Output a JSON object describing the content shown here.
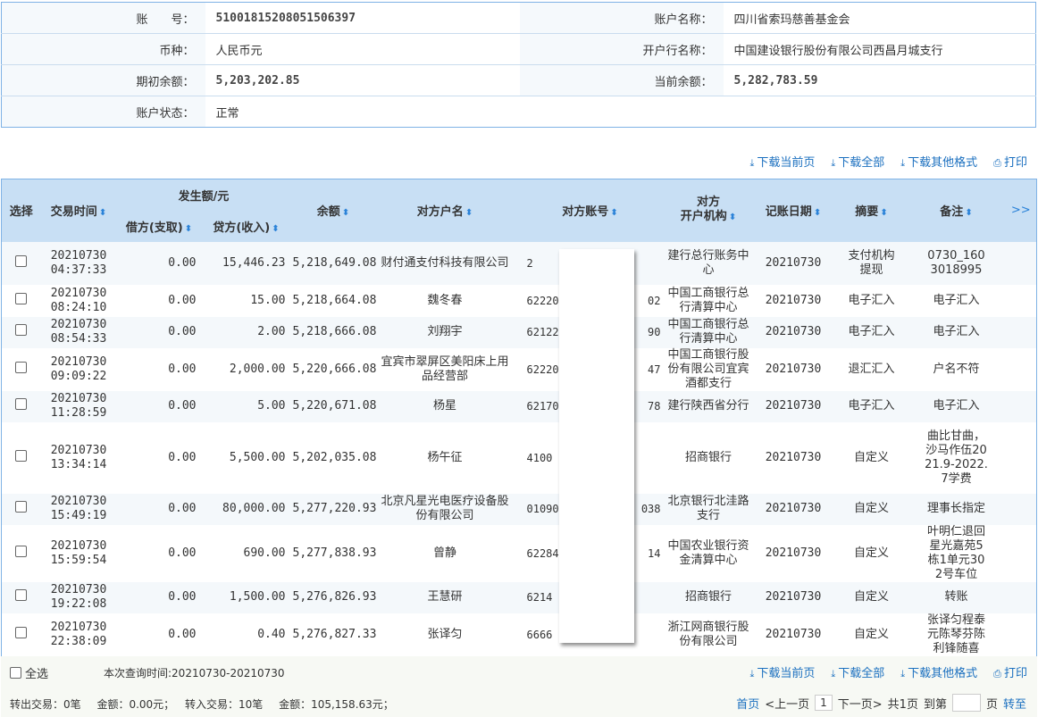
{
  "account": {
    "account_no_label": "账　　号：",
    "account_no": "51001815208051506397",
    "account_name_label": "账户名称：",
    "account_name": "四川省索玛慈善基金会",
    "currency_label": "币种：",
    "currency": "人民币元",
    "bank_label": "开户行名称：",
    "bank": "中国建设银行股份有限公司西昌月城支行",
    "opening_label": "期初余额：",
    "opening": "5,203,202.85",
    "current_label": "当前余额：",
    "current": "5,282,783.59",
    "status_label": "账户状态：",
    "status": "正常"
  },
  "actions": {
    "download_page": "下载当前页",
    "download_all": "下载全部",
    "download_other": "下载其他格式",
    "print": "打印"
  },
  "table": {
    "headers": {
      "select": "选择",
      "time": "交易时间",
      "amount_group": "发生额/元",
      "debit": "借方(支取)",
      "credit": "贷方(收入)",
      "balance": "余额",
      "cp_name": "对方户名",
      "cp_account": "对方账号",
      "cp_bank_1": "对方",
      "cp_bank_2": "开户机构",
      "post_date": "记账日期",
      "summary": "摘要",
      "remark": "备注",
      "more": ">>"
    },
    "rows": [
      {
        "date": "20210730",
        "time": "04:37:33",
        "debit": "0.00",
        "credit": "15,446.23",
        "balance": "5,218,649.08",
        "cp_name": "财付通支付科技有限公司",
        "acct_head": "2",
        "acct_tail": "",
        "cp_bank": "建行总行账务中心",
        "post_date": "20210730",
        "summary": "支付机构提现",
        "remark": "0730_1603018995"
      },
      {
        "date": "20210730",
        "time": "08:24:10",
        "debit": "0.00",
        "credit": "15.00",
        "balance": "5,218,664.08",
        "cp_name": "魏冬春",
        "acct_head": "622202",
        "acct_tail": "02",
        "cp_bank": "中国工商银行总行清算中心",
        "post_date": "20210730",
        "summary": "电子汇入",
        "remark": "电子汇入"
      },
      {
        "date": "20210730",
        "time": "08:54:33",
        "debit": "0.00",
        "credit": "2.00",
        "balance": "5,218,666.08",
        "cp_name": "刘翔宇",
        "acct_head": "621225",
        "acct_tail": "90",
        "cp_bank": "中国工商银行总行清算中心",
        "post_date": "20210730",
        "summary": "电子汇入",
        "remark": "电子汇入"
      },
      {
        "date": "20210730",
        "time": "09:09:22",
        "debit": "0.00",
        "credit": "2,000.00",
        "balance": "5,220,666.08",
        "cp_name": "宜宾市翠屏区美阳床上用品经营部",
        "acct_head": "622208",
        "acct_tail": "47",
        "cp_bank": "中国工商银行股份有限公司宜宾酒都支行",
        "post_date": "20210730",
        "summary": "退汇汇入",
        "remark": "户名不符"
      },
      {
        "date": "20210730",
        "time": "11:28:59",
        "debit": "0.00",
        "credit": "5.00",
        "balance": "5,220,671.08",
        "cp_name": "杨星",
        "acct_head": "621700",
        "acct_tail": "78",
        "cp_bank": "建行陕西省分行",
        "post_date": "20210730",
        "summary": "电子汇入",
        "remark": "电子汇入"
      },
      {
        "date": "20210730",
        "time": "13:34:14",
        "debit": "0.00",
        "credit": "5,500.00",
        "balance": "5,202,035.08",
        "cp_name": "杨午征",
        "acct_head": "4100",
        "acct_tail": "",
        "cp_bank": "招商银行",
        "post_date": "20210730",
        "summary": "自定义",
        "remark": "曲比甘曲，沙马作伍2021.9-2022.7学费"
      },
      {
        "date": "20210730",
        "time": "15:49:19",
        "debit": "0.00",
        "credit": "80,000.00",
        "balance": "5,277,220.93",
        "cp_name": "北京凡星光电医疗设备股份有限公司",
        "acct_head": "01090",
        "acct_tail": "038",
        "cp_bank": "北京银行北洼路支行",
        "post_date": "20210730",
        "summary": "自定义",
        "remark": "理事长指定"
      },
      {
        "date": "20210730",
        "time": "15:59:54",
        "debit": "0.00",
        "credit": "690.00",
        "balance": "5,277,838.93",
        "cp_name": "曾静",
        "acct_head": "622848",
        "acct_tail": "14",
        "cp_bank": "中国农业银行资金清算中心",
        "post_date": "20210730",
        "summary": "自定义",
        "remark": "叶明仁退回星光嘉苑5栋1单元302号车位"
      },
      {
        "date": "20210730",
        "time": "19:22:08",
        "debit": "0.00",
        "credit": "1,500.00",
        "balance": "5,276,826.93",
        "cp_name": "王慧研",
        "acct_head": "6214",
        "acct_tail": "",
        "cp_bank": "招商银行",
        "post_date": "20210730",
        "summary": "自定义",
        "remark": "转账"
      },
      {
        "date": "20210730",
        "time": "22:38:09",
        "debit": "0.00",
        "credit": "0.40",
        "balance": "5,276,827.33",
        "cp_name": "张译匀",
        "acct_head": "6666",
        "acct_tail": "",
        "cp_bank": "浙江网商银行股份有限公司",
        "post_date": "20210730",
        "summary": "自定义",
        "remark": "张译匀程泰元陈琴芬陈利锋随喜"
      }
    ]
  },
  "footer": {
    "select_all": "全选",
    "query_time": "本次查询时间:20210730-20210730",
    "summary": "转出交易：0笔　 金额：0.00元；　 转入交易：10笔　 金额：105,158.63元；"
  },
  "pager": {
    "first": "首页",
    "prev": "<上一页",
    "current": "1",
    "next": "下一页>",
    "total": "共1页",
    "goto_label": "到第",
    "page_unit": "页",
    "go": "转至"
  }
}
